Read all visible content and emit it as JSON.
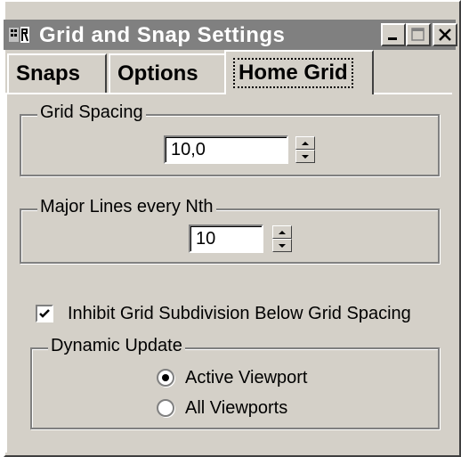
{
  "window": {
    "title": "Grid and Snap Settings",
    "icon": "app-icon",
    "controls": {
      "minimize_icon": "minimize-icon",
      "maximize_icon": "maximize-icon",
      "close_icon": "close-icon"
    }
  },
  "tabs": [
    {
      "label": "Snaps",
      "active": false
    },
    {
      "label": "Options",
      "active": false
    },
    {
      "label": "Home Grid",
      "active": true
    }
  ],
  "grid_spacing": {
    "legend": "Grid Spacing",
    "value": "10,0"
  },
  "major_lines": {
    "legend": "Major Lines every Nth",
    "value": "10"
  },
  "inhibit": {
    "label": "Inhibit Grid Subdivision Below Grid Spacing",
    "checked": true
  },
  "dynamic_update": {
    "legend": "Dynamic Update",
    "options": [
      {
        "label": "Active Viewport",
        "selected": true
      },
      {
        "label": "All Viewports",
        "selected": false
      }
    ]
  }
}
